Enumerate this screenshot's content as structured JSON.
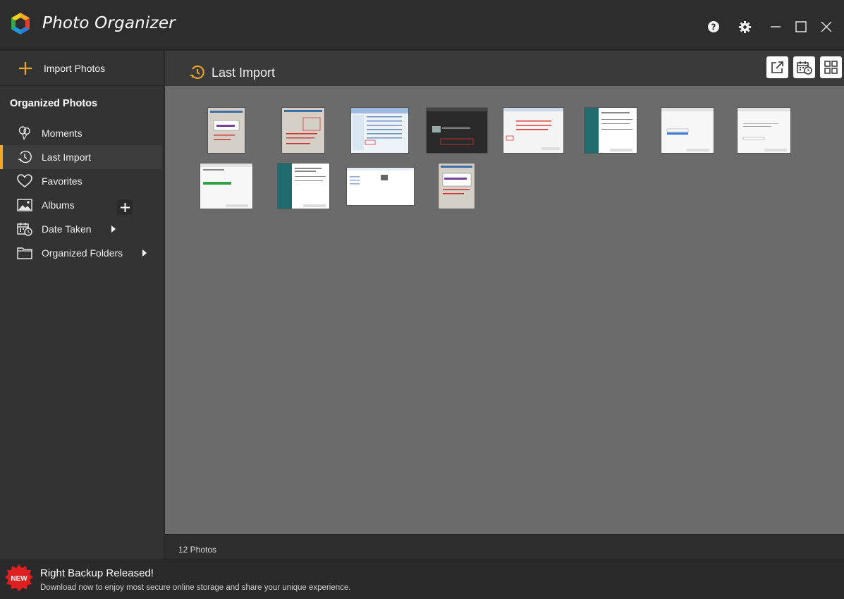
{
  "app": {
    "title": "Photo Organizer"
  },
  "titlebar": {
    "help_icon": "help-icon",
    "settings_icon": "gear-icon",
    "minimize_icon": "minimize-icon",
    "maximize_icon": "maximize-icon",
    "close_icon": "close-icon"
  },
  "sidebar": {
    "import_label": "Import Photos",
    "section_title": "Organized Photos",
    "items": [
      {
        "label": "Moments",
        "icon": "balloons-icon",
        "active": false
      },
      {
        "label": "Last Import",
        "icon": "clock-arrow-icon",
        "active": true
      },
      {
        "label": "Favorites",
        "icon": "heart-icon",
        "active": false
      },
      {
        "label": "Albums",
        "icon": "image-icon",
        "active": false
      },
      {
        "label": "Date Taken",
        "icon": "calendar-clock-icon",
        "active": false
      },
      {
        "label": "Organized Folders",
        "icon": "folder-icon",
        "active": false
      }
    ]
  },
  "main": {
    "title": "Last Import",
    "toolbar": {
      "export_icon": "external-link-icon",
      "calendar_icon": "calendar-clock-icon",
      "grid_icon": "grid-view-icon"
    },
    "photo_count_label": "12 Photos"
  },
  "banner": {
    "badge_text": "NEW",
    "headline": "Right Backup Released!",
    "subtext": "Download now to enjoy most secure online storage and share your unique experience."
  },
  "colors": {
    "accent": "#f5a623",
    "sidebar_bg": "#333333",
    "grid_bg": "#6b6b6b",
    "badge_red": "#e02020"
  }
}
